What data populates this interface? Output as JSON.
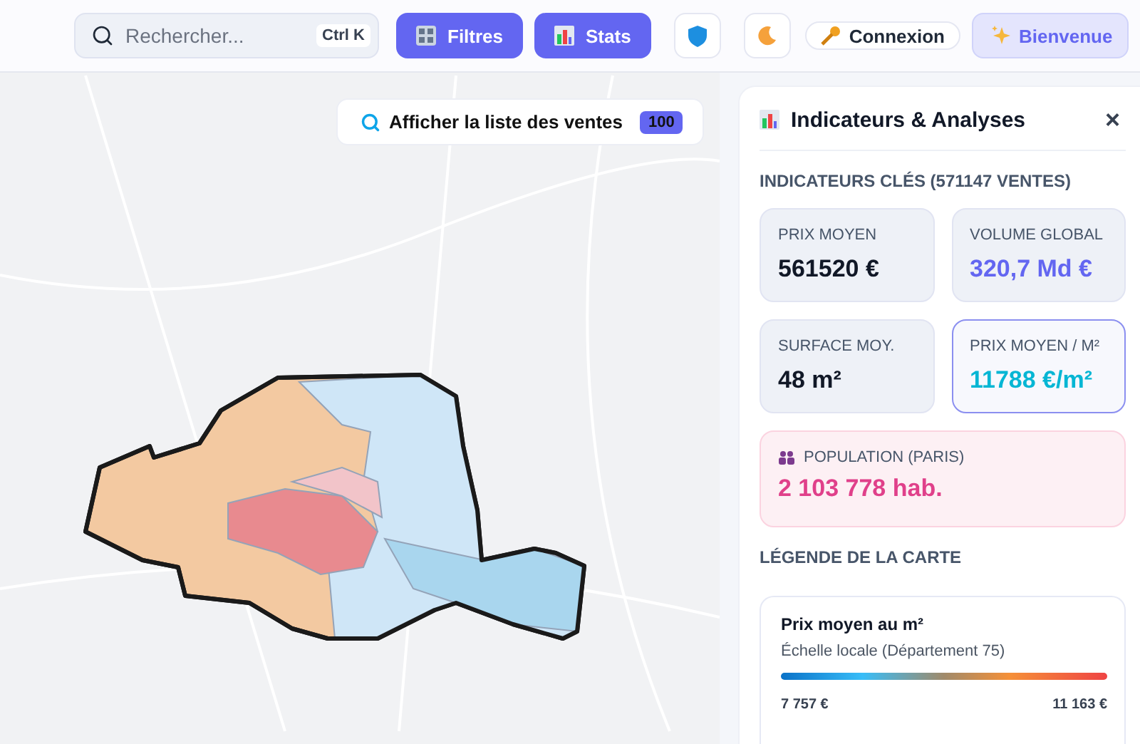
{
  "topbar": {
    "search": {
      "placeholder": "Rechercher...",
      "shortcut": "Ctrl K"
    },
    "buttons": [
      {
        "kind": "primary",
        "label": "Filtres"
      },
      {
        "kind": "primary",
        "label": "Stats"
      },
      {
        "kind": "icon"
      },
      {
        "kind": "icon"
      },
      {
        "kind": "pill",
        "label": "Connexion"
      },
      {
        "kind": "soft",
        "label": "Bienvenue"
      }
    ]
  },
  "map": {
    "list_button": {
      "label": "Afficher la liste des ventes",
      "count": "100"
    }
  },
  "panel": {
    "title": "Indicateurs & Analyses",
    "close": "×",
    "section": "INDICATEURS CLÉS (571147 VENTES)",
    "cards": [
      {
        "label": "PRIX MOYEN",
        "value": "561520 €",
        "color": "#111827",
        "highlighted": false
      },
      {
        "label": "VOLUME GLOBAL",
        "value": "320,7 Md €",
        "color": "#6366f1",
        "highlighted": false
      },
      {
        "label": "SURFACE MOY.",
        "value": "48 m²",
        "color": "#111827",
        "highlighted": false
      },
      {
        "label": "PRIX MOYEN / M²",
        "value": "11788 €/m²",
        "color": "#06b6d4",
        "highlighted": true
      }
    ],
    "population": {
      "label": "POPULATION (PARIS)",
      "value": "2 103 778 hab."
    },
    "legend_title": "LÉGENDE DE LA CARTE",
    "legend": {
      "title": "Prix moyen au m²",
      "subtitle": "Échelle locale (Département 75)",
      "min": "7 757 €",
      "max": "11 163 €"
    }
  }
}
